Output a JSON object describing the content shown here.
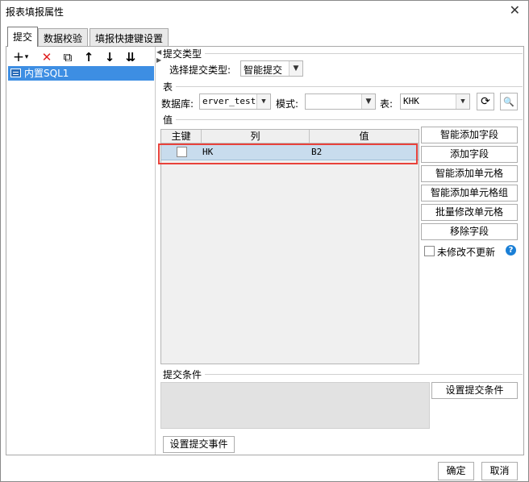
{
  "window": {
    "title": "报表填报属性",
    "close_glyph": "✕"
  },
  "tabs": [
    {
      "label": "提交",
      "active": true
    },
    {
      "label": "数据校验",
      "active": false
    },
    {
      "label": "填报快捷键设置",
      "active": false
    }
  ],
  "toolbar": {
    "add_icon": "+",
    "dropdown_icon": "▾",
    "delete_icon": "✕",
    "copy_icon": "⧉",
    "up_icon": "↑",
    "down_icon": "↓",
    "move_bottom_icon": "⇊"
  },
  "tree": {
    "items": [
      {
        "label": "内置SQL1",
        "selected": true
      }
    ]
  },
  "submit_type": {
    "group_title": "提交类型",
    "label": "选择提交类型:",
    "value": "智能提交"
  },
  "table_group": {
    "group_title": "表",
    "db_label": "数据库:",
    "db_value": "erver_test",
    "schema_label": "模式:",
    "schema_value": "",
    "table_label": "表:",
    "table_value": "KHK",
    "refresh_icon": "⟳",
    "preview_icon": "🔍"
  },
  "values_group": {
    "group_title": "值",
    "columns": [
      "主键",
      "列",
      "值"
    ],
    "rows": [
      {
        "key": false,
        "column": "HK",
        "value": "B2"
      }
    ]
  },
  "buttons": {
    "smart_add_field": "智能添加字段",
    "add_field": "添加字段",
    "smart_add_cell": "智能添加单元格",
    "smart_add_cell_group": "智能添加单元格组",
    "batch_modify_cell": "批量修改单元格",
    "remove_field": "移除字段",
    "unmodified_no_update": "未修改不更新",
    "help_glyph": "?"
  },
  "condition": {
    "group_title": "提交条件",
    "set_condition": "设置提交条件",
    "set_event": "设置提交事件"
  },
  "footer": {
    "ok": "确定",
    "cancel": "取消"
  },
  "colors": {
    "selection": "#3d8ee3",
    "row_highlight": "#c8dced",
    "annotation_box": "#e8423b",
    "delete_red": "#e02020",
    "help_blue": "#1a7fd6"
  }
}
